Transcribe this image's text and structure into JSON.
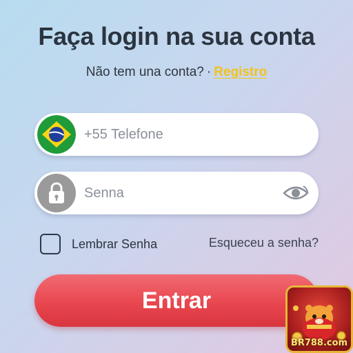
{
  "header": {
    "title": "Faça login na sua conta",
    "no_account_text": "Não tem una conta?",
    "separator": "·",
    "register_link": "Registro"
  },
  "form": {
    "phone": {
      "placeholder": "+55 Telefone",
      "flag_icon": "brazil-flag-icon"
    },
    "password": {
      "placeholder": "Senna",
      "lock_icon": "lock-icon",
      "eye_icon": "eye-icon"
    },
    "remember_label": "Lembrar Senha",
    "forgot_link": "Esqueceu a senha?",
    "submit_label": "Entrar"
  },
  "badge": {
    "logo_text": "BR788.com"
  },
  "colors": {
    "accent_red": "#e9474f",
    "link_yellow": "#f2c21b",
    "text_dark": "#2b3440"
  }
}
